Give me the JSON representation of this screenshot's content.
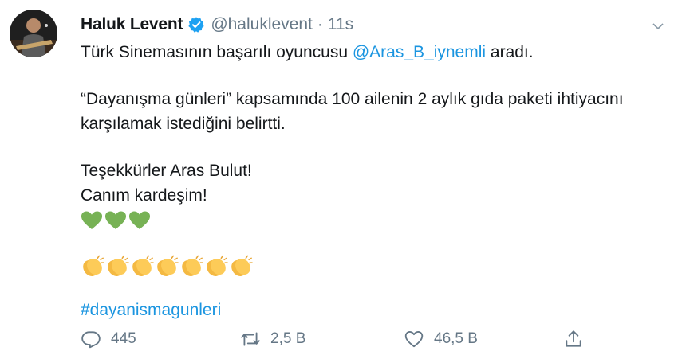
{
  "tweet": {
    "author": {
      "name": "Haluk Levent",
      "handle": "@haluklevent",
      "separator": "·",
      "time": "11s",
      "verified": true
    },
    "text": {
      "line1_before": "Türk Sinemasının başarılı oyuncusu ",
      "line1_mention": "@Aras_B_iynemli",
      "line1_after": " aradı.",
      "line2": "“Dayanışma günleri” kapsamında 100 ailenin 2 aylık gıda paketi ihtiyacını",
      "line3": "karşılamak istediğini belirtti.",
      "line4": "Teşekkürler Aras Bulut!",
      "line5": "Canım kardeşim!",
      "hashtag": "#dayanismagunleri"
    },
    "emojis": {
      "hearts": [
        "green-heart",
        "green-heart",
        "green-heart"
      ],
      "claps": [
        "clapping-hands",
        "clapping-hands",
        "clapping-hands",
        "clapping-hands",
        "clapping-hands",
        "clapping-hands",
        "clapping-hands"
      ]
    },
    "actions": {
      "reply_count": "445",
      "retweet_count": "2,5 B",
      "like_count": "46,5 B"
    },
    "colors": {
      "link": "#1b95e0",
      "verified": "#1da1f2",
      "muted": "#657786",
      "heart": "#77b255",
      "clap": "#fdcb58"
    }
  }
}
